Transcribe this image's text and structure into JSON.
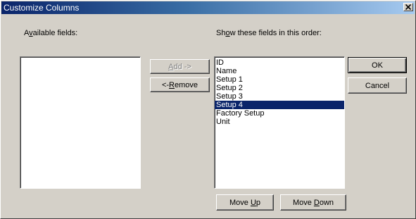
{
  "window": {
    "title": "Customize Columns",
    "close_icon": "close-x-icon"
  },
  "available": {
    "label_prefix": "A",
    "label_accel": "v",
    "label_rest": "ailable fields:",
    "items": []
  },
  "shown": {
    "label_prefix": "Sh",
    "label_accel": "o",
    "label_rest": "w these fields in this order:",
    "items": [
      "ID",
      "Name",
      "Setup 1",
      "Setup 2",
      "Setup 3",
      "Setup 4",
      "Factory Setup",
      "Unit"
    ],
    "selected_item": "Setup 4"
  },
  "buttons": {
    "add": {
      "accel": "A",
      "rest": "dd ->",
      "enabled": false
    },
    "remove": {
      "prefix": "<- ",
      "accel": "R",
      "rest": "emove"
    },
    "ok": "OK",
    "cancel": "Cancel",
    "move_up": {
      "prefix": "Move ",
      "accel": "U",
      "rest": "p"
    },
    "move_down": {
      "prefix": "Move ",
      "accel": "D",
      "rest": "own"
    }
  }
}
